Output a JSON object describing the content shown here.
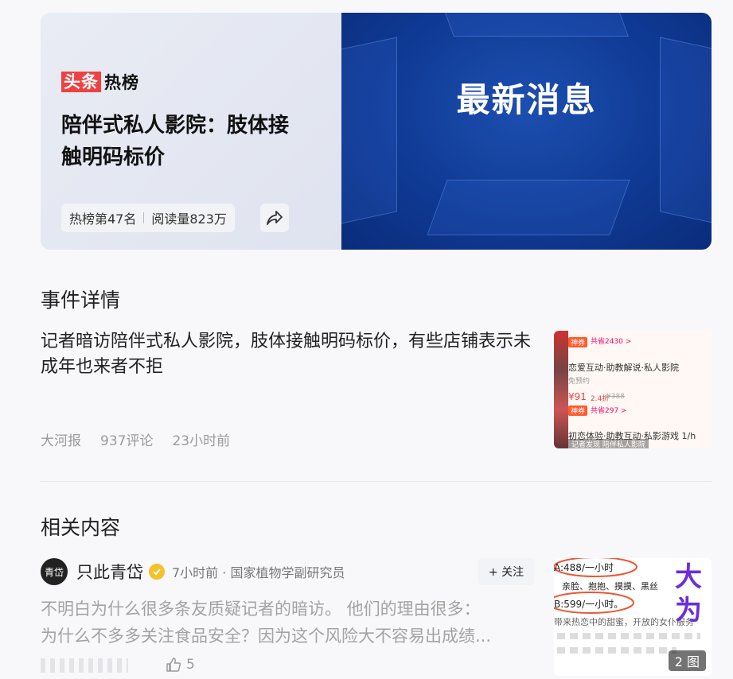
{
  "hero": {
    "brand_red": "头条",
    "brand_black": "热榜",
    "title": "陪伴式私人影院：肢体接触明码标价",
    "rank": "热榜第47名",
    "reads": "阅读量823万",
    "banner_text": "最新消息"
  },
  "event": {
    "section_title": "事件详情",
    "text": "记者暗访陪伴式私人影院，肢体接触明码标价，有些店铺表示未成年也来者不拒",
    "source": "大河报",
    "comments": "937评论",
    "time": "23小时前",
    "thumbnail": {
      "tag1": "神券",
      "saving1": "共省2430 >",
      "line1": "恋爱互动·助教解说·私人影院",
      "line2": "免预约",
      "price": "¥91",
      "discount": "2.4折",
      "old_price": "¥388",
      "tag2": "神券",
      "saving2": "共省297 >",
      "line3": "初恋体验·助教互动·私影游戏 1/h",
      "caption": "记者发现 陪伴私人影院"
    }
  },
  "related": {
    "section_title": "相关内容",
    "avatar_text": "青岱",
    "author": "只此青岱",
    "meta": "7小时前 · 国家植物学副研究员",
    "follow_label": "+ 关注",
    "text_line1": "不明白为什么很多条友质疑记者的暗访。 他们的理由很多：",
    "text_line2": "为什么不多多关注食品安全？因为这个风险大不容易出成绩...",
    "likes": "5",
    "image_count": "2 图",
    "thumbnail": {
      "line_a": "A:488/一小时",
      "line_a2": "亲脸、抱抱、摸摸、黑丝",
      "line_b": "B:599/一小时。",
      "line_c": "带来热恋中的甜蜜，开放的女仆服务",
      "big1": "大",
      "big2": "为"
    }
  },
  "colors": {
    "brand_red": "#f04142",
    "banner_blue": "#0f3a94",
    "verified_gold": "#f3c12a",
    "muted_text": "#a3a3a3"
  },
  "icons": [
    "share-icon",
    "verified-icon",
    "thumb-up-icon"
  ]
}
